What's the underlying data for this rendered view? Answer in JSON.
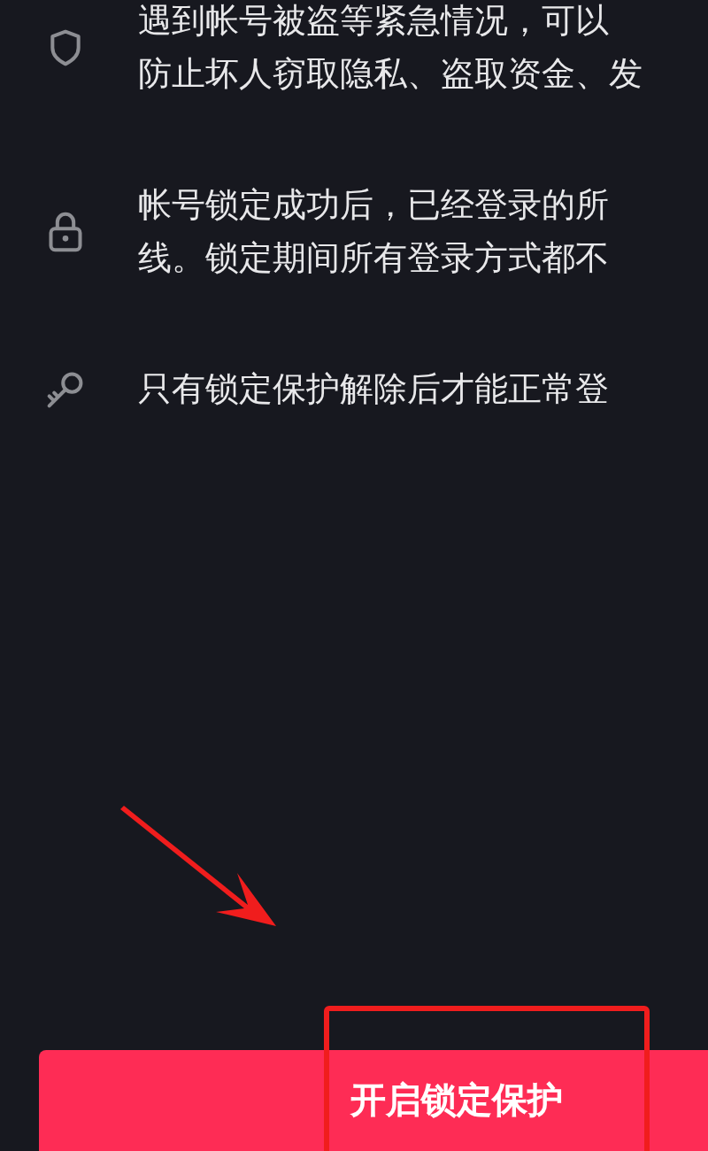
{
  "items": [
    {
      "kind": "shield",
      "lines": [
        "遇到帐号被盗等紧急情况，可以",
        "防止坏人窃取隐私、盗取资金、发"
      ]
    },
    {
      "kind": "lock",
      "lines": [
        "帐号锁定成功后，已经登录的所",
        "线。锁定期间所有登录方式都不"
      ]
    },
    {
      "kind": "key",
      "lines": [
        "只有锁定保护解除后才能正常登"
      ]
    }
  ],
  "button": {
    "label": "开启锁定保护"
  }
}
